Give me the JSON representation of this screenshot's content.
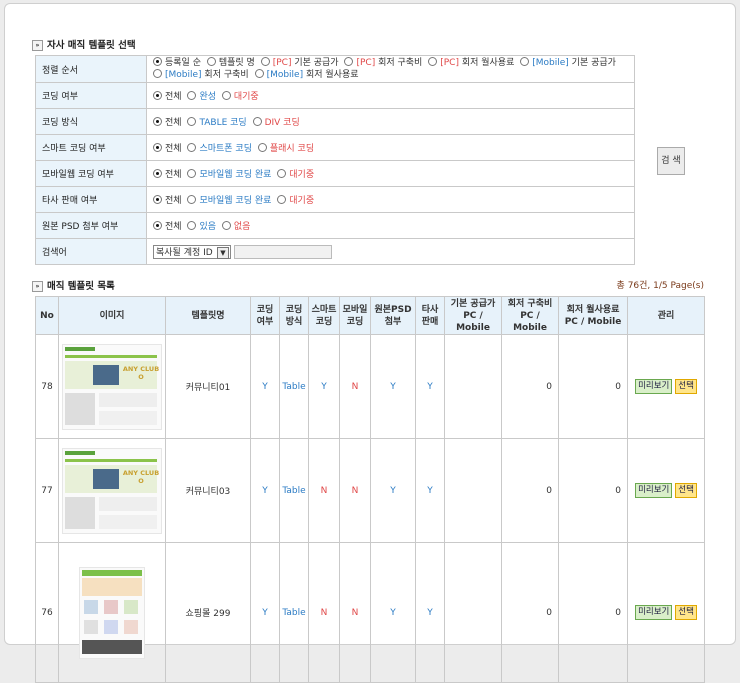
{
  "sections": {
    "filter_title": "자사 매직 템플릿 선택",
    "list_title": "매직 템플릿 목록",
    "bullet": "»"
  },
  "filters": {
    "sort": {
      "label": "정렬 순서",
      "opt1": "등록일 순",
      "opt2": "템플릿 명",
      "opt3_tag": "[PC]",
      "opt3": "기본 공급가",
      "opt4_tag": "[PC]",
      "opt4": "회저 구축비",
      "opt5_tag": "[PC]",
      "opt5": "회저 월사용료",
      "opt6_tag": "[Mobile]",
      "opt6": "기본 공급가",
      "opt7_tag": "[Mobile]",
      "opt7": "회저 구축비",
      "opt8_tag": "[Mobile]",
      "opt8": "회저 월사용료"
    },
    "coding": {
      "label": "코딩 여부",
      "opt1": "전체",
      "opt2": "완성",
      "opt3": "대기중"
    },
    "coding_method": {
      "label": "코딩 방식",
      "opt1": "전체",
      "opt2": "TABLE 코딩",
      "opt3": "DIV 코딩"
    },
    "smart": {
      "label": "스마트 코딩 여부",
      "opt1": "전체",
      "opt2": "스마트폰 코딩",
      "opt3": "플래시 코딩"
    },
    "mobile": {
      "label": "모바일웹 코딩 여부",
      "opt1": "전체",
      "opt2": "모바일웹 코딩 완료",
      "opt3": "대기중"
    },
    "resale": {
      "label": "타사 판매 여부",
      "opt1": "전체",
      "opt2": "모바일웹 코딩 완료",
      "opt3": "대기중"
    },
    "psd": {
      "label": "원본 PSD 첨부 여부",
      "opt1": "전체",
      "opt2": "있음",
      "opt3": "없음"
    },
    "keyword": {
      "label": "검색어",
      "select_value": "복사될 계정 ID",
      "arrow": "▼"
    }
  },
  "search_button": "검 색",
  "count_text": "총 76건, 1/5 Page(s)",
  "table": {
    "headers": {
      "no": "No",
      "image": "이미지",
      "name": "템플릿명",
      "coding_1": "코딩",
      "coding_2": "여부",
      "method_1": "코딩",
      "method_2": "방식",
      "smart_1": "스마트",
      "smart_2": "코딩",
      "mobile_1": "모바일",
      "mobile_2": "코딩",
      "psd_1": "원본PSD",
      "psd_2": "첨부",
      "resale_1": "타사",
      "resale_2": "판매",
      "base_1": "기본 공급가",
      "base_2": "PC / Mobile",
      "build_1": "회저 구축비",
      "build_2": "PC / Mobile",
      "monthly_1": "회저 월사용료",
      "monthly_2": "PC / Mobile",
      "manage": "관리"
    },
    "rows": [
      {
        "no": "78",
        "name": "커뮤니티01",
        "coding": "Y",
        "method": "Table",
        "smart": "Y",
        "mobile": "N",
        "psd": "Y",
        "resale": "Y",
        "base": "",
        "build": "0",
        "monthly": "0",
        "preview": "미리보기",
        "select": "선택",
        "thumb_text": "ANY CLUB O"
      },
      {
        "no": "77",
        "name": "커뮤니티03",
        "coding": "Y",
        "method": "Table",
        "smart": "N",
        "mobile": "N",
        "psd": "Y",
        "resale": "Y",
        "base": "",
        "build": "0",
        "monthly": "0",
        "preview": "미리보기",
        "select": "선택",
        "thumb_text": "ANY CLUB O"
      },
      {
        "no": "76",
        "name": "쇼핑몰 299",
        "coding": "Y",
        "method": "Table",
        "smart": "N",
        "mobile": "N",
        "psd": "Y",
        "resale": "Y",
        "base": "",
        "build": "0",
        "monthly": "0",
        "preview": "미리보기",
        "select": "선택",
        "thumb_text": ""
      }
    ]
  },
  "colors": {
    "header_bg": "#e7f2fa",
    "accent_blue": "#2b7bc4",
    "accent_red": "#e04848"
  }
}
